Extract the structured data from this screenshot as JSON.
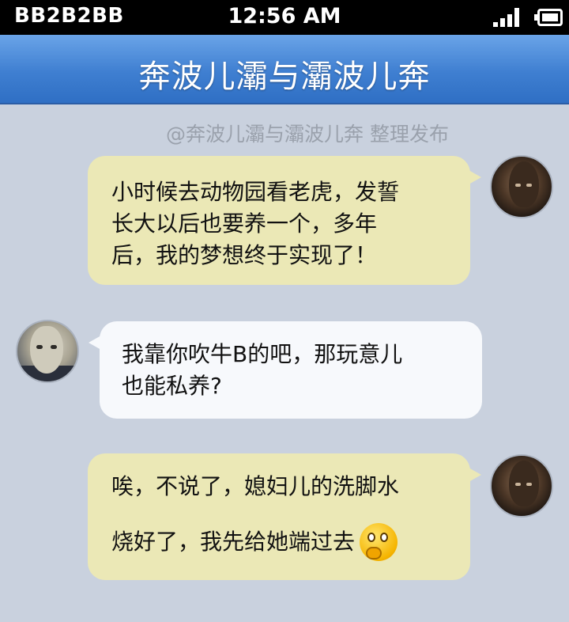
{
  "status_bar": {
    "carrier": "BB2B2BB",
    "time": "12:56 AM",
    "signal_icon": "signal-bars-icon",
    "battery_icon": "battery-icon"
  },
  "header": {
    "title": "奔波儿灞与灞波儿奔"
  },
  "credit": "@奔波儿灞与灞波儿奔 整理发布",
  "colors": {
    "title_bar": "#3f7fd1",
    "background": "#c9d1de",
    "bubble_right": "#ebe8b6",
    "bubble_left": "#f7f9fc"
  },
  "messages": [
    {
      "side": "right",
      "lines": [
        "小时候去动物园看老虎，发誓",
        "长大以后也要养一个，多年",
        "后，我的梦想终于实现了！"
      ]
    },
    {
      "side": "left",
      "lines": [
        "我靠你吹牛B的吧，那玩意儿",
        "也能私养?"
      ]
    },
    {
      "side": "right",
      "lines": [
        "唉，不说了，媳妇儿的洗脚水",
        "烧好了，我先给她端过去"
      ],
      "emoji": "thinking-emoji-icon"
    }
  ]
}
